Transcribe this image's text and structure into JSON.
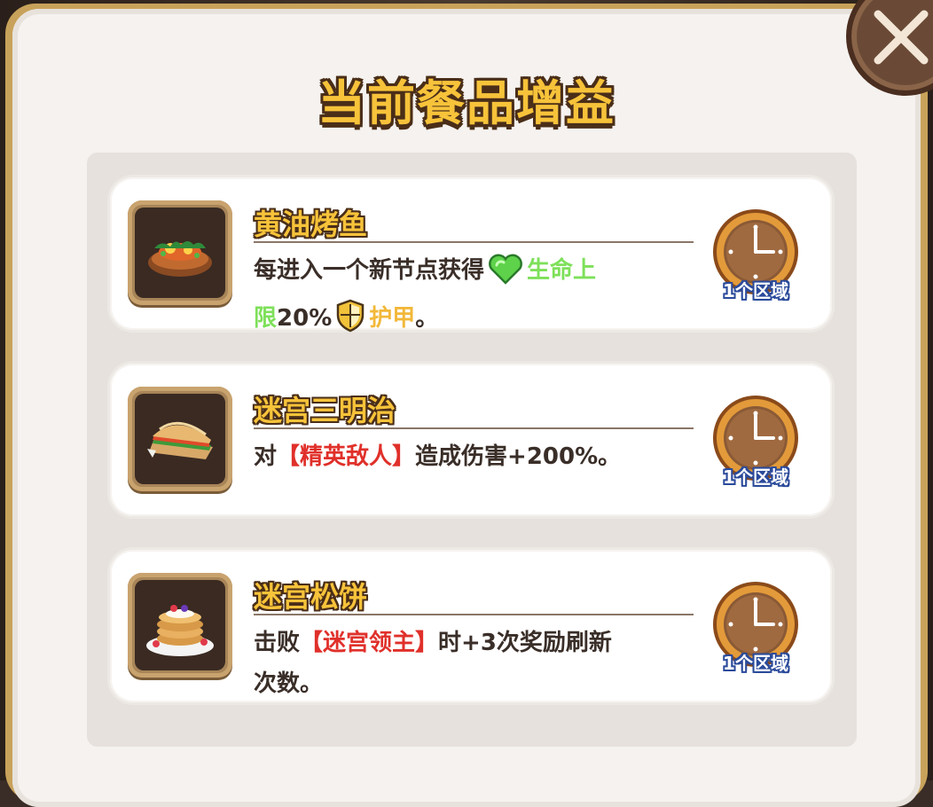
{
  "dialog": {
    "title": "当前餐品增益",
    "close_icon": "close-x-icon"
  },
  "buffs": [
    {
      "name": "黄油烤鱼",
      "icon": "grilled-fish-icon",
      "desc_parts": [
        "每进入一个新节点获得",
        "生命上",
        "限",
        "20%",
        "护甲",
        "。"
      ],
      "duration": "1个区域"
    },
    {
      "name": "迷宫三明治",
      "icon": "sandwich-icon",
      "desc_parts": [
        "对",
        "【精英敌人】",
        "造成伤害+200%。"
      ],
      "duration": "1个区域"
    },
    {
      "name": "迷宫松饼",
      "icon": "pancake-icon",
      "desc_parts": [
        "击败",
        "【迷宫领主】",
        "时+3次奖励刷新",
        "次数。"
      ],
      "duration": "1个区域"
    }
  ],
  "colors": {
    "title_gold": "#f7c33a",
    "health_green": "#7ee05a",
    "armor_orange": "#f2b83a",
    "enemy_red": "#e0302a",
    "duration_blue_outline": "#2a4a9a"
  }
}
